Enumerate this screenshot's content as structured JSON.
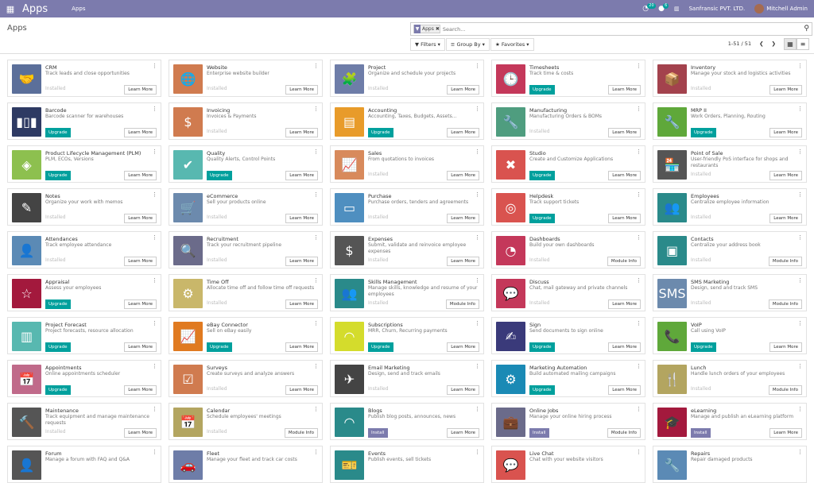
{
  "navbar": {
    "brand": "Apps",
    "menu": "Apps",
    "chat_count": "20",
    "activity_count": "6",
    "company": "Sanfransic PVT. LTD.",
    "user": "Mitchell Admin"
  },
  "page": {
    "title": "Apps"
  },
  "search": {
    "facet": "Apps",
    "placeholder": "Search..."
  },
  "filters": {
    "filters": "Filters",
    "group_by": "Group By",
    "favorites": "Favorites"
  },
  "pager": {
    "range": "1-51 / 51"
  },
  "colors": {
    "navbar": "#7c7bad",
    "teal": "#00a09d"
  },
  "apps": [
    {
      "name": "CRM",
      "desc": "Track leads and close opportunities",
      "state": "Installed",
      "action": "Learn More",
      "color": "#5b6f9a",
      "icon": "handshake-icon",
      "glyph": "🤝"
    },
    {
      "name": "Website",
      "desc": "Enterprise website builder",
      "state": "Installed",
      "action": "Learn More",
      "color": "#d07b4f",
      "icon": "globe-icon",
      "glyph": "🌐"
    },
    {
      "name": "Project",
      "desc": "Organize and schedule your projects",
      "state": "Installed",
      "action": "Learn More",
      "color": "#6e7da8",
      "icon": "puzzle-icon",
      "glyph": "🧩"
    },
    {
      "name": "Timesheets",
      "desc": "Track time & costs",
      "state": "Upgrade",
      "action": "Learn More",
      "color": "#c4385a",
      "icon": "clock-icon",
      "glyph": "🕒"
    },
    {
      "name": "Inventory",
      "desc": "Manage your stock and logistics activities",
      "state": "Installed",
      "action": "Learn More",
      "color": "#a3424d",
      "icon": "box-icon",
      "glyph": "📦"
    },
    {
      "name": "Barcode",
      "desc": "Barcode scanner for warehouses",
      "state": "Upgrade",
      "action": "Learn More",
      "color": "#2e3a63",
      "icon": "barcode-icon",
      "glyph": "▮▯▮"
    },
    {
      "name": "Invoicing",
      "desc": "Invoices & Payments",
      "state": "Installed",
      "action": "Learn More",
      "color": "#d07b4f",
      "icon": "invoice-icon",
      "glyph": "$"
    },
    {
      "name": "Accounting",
      "desc": "Accounting, Taxes, Budgets, Assets...",
      "state": "Upgrade",
      "action": "Learn More",
      "color": "#e89b2a",
      "icon": "document-icon",
      "glyph": "▤"
    },
    {
      "name": "Manufacturing",
      "desc": "Manufacturing Orders & BOMs",
      "state": "Installed",
      "action": "Learn More",
      "color": "#4f9d7f",
      "icon": "wrench-icon",
      "glyph": "🔧"
    },
    {
      "name": "MRP II",
      "desc": "Work Orders, Planning, Routing",
      "state": "Upgrade",
      "action": "Learn More",
      "color": "#5fa83a",
      "icon": "wrench-icon",
      "glyph": "🔧"
    },
    {
      "name": "Product Lifecycle Management (PLM)",
      "desc": "PLM, ECOs, Versions",
      "state": "Upgrade",
      "action": "Learn More",
      "color": "#8dc04f",
      "icon": "cube-icon",
      "glyph": "◈"
    },
    {
      "name": "Quality",
      "desc": "Quality Alerts, Control Points",
      "state": "Upgrade",
      "action": "Learn More",
      "color": "#58b8b0",
      "icon": "clipboard-check-icon",
      "glyph": "✔"
    },
    {
      "name": "Sales",
      "desc": "From quotations to invoices",
      "state": "Installed",
      "action": "Learn More",
      "color": "#d88a5c",
      "icon": "chart-line-icon",
      "glyph": "📈"
    },
    {
      "name": "Studio",
      "desc": "Create and Customize Applications",
      "state": "Upgrade",
      "action": "Learn More",
      "color": "#d9534f",
      "icon": "tools-icon",
      "glyph": "✖"
    },
    {
      "name": "Point of Sale",
      "desc": "User-friendly PoS interface for shops and restaurants",
      "state": "Installed",
      "action": "Learn More",
      "color": "#555555",
      "icon": "shop-icon",
      "glyph": "🏪"
    },
    {
      "name": "Notes",
      "desc": "Organize your work with memos",
      "state": "Installed",
      "action": "Learn More",
      "color": "#444444",
      "icon": "note-icon",
      "glyph": "✎"
    },
    {
      "name": "eCommerce",
      "desc": "Sell your products online",
      "state": "Installed",
      "action": "Learn More",
      "color": "#6c8aad",
      "icon": "cart-icon",
      "glyph": "🛒"
    },
    {
      "name": "Purchase",
      "desc": "Purchase orders, tenders and agreements",
      "state": "Installed",
      "action": "Learn More",
      "color": "#4f8fc0",
      "icon": "credit-card-icon",
      "glyph": "▭"
    },
    {
      "name": "Helpdesk",
      "desc": "Track support tickets",
      "state": "Upgrade",
      "action": "Learn More",
      "color": "#d9534f",
      "icon": "lifebuoy-icon",
      "glyph": "◎"
    },
    {
      "name": "Employees",
      "desc": "Centralize employee information",
      "state": "Installed",
      "action": "Learn More",
      "color": "#2a8a8a",
      "icon": "users-icon",
      "glyph": "👥"
    },
    {
      "name": "Attendances",
      "desc": "Track employee attendance",
      "state": "Installed",
      "action": "Learn More",
      "color": "#5b8ab5",
      "icon": "user-clock-icon",
      "glyph": "👤"
    },
    {
      "name": "Recruitment",
      "desc": "Track your recruitment pipeline",
      "state": "Installed",
      "action": "Learn More",
      "color": "#6b6b8a",
      "icon": "magnifier-icon",
      "glyph": "🔍"
    },
    {
      "name": "Expenses",
      "desc": "Submit, validate and reinvoice employee expenses",
      "state": "Installed",
      "action": "Learn More",
      "color": "#555555",
      "icon": "user-dollar-icon",
      "glyph": "$"
    },
    {
      "name": "Dashboards",
      "desc": "Build your own dashboards",
      "state": "Installed",
      "action": "Module Info",
      "color": "#c4385a",
      "icon": "gauge-icon",
      "glyph": "◔"
    },
    {
      "name": "Contacts",
      "desc": "Centralize your address book",
      "state": "Installed",
      "action": "Module Info",
      "color": "#2a8a8a",
      "icon": "contact-card-icon",
      "glyph": "▣"
    },
    {
      "name": "Appraisal",
      "desc": "Assess your employees",
      "state": "Upgrade",
      "action": "Learn More",
      "color": "#a3193d",
      "icon": "star-icon",
      "glyph": "☆"
    },
    {
      "name": "Time Off",
      "desc": "Allocate time off and follow time off requests",
      "state": "Installed",
      "action": "Learn More",
      "color": "#c9b76a",
      "icon": "user-gear-icon",
      "glyph": "⚙"
    },
    {
      "name": "Skills Management",
      "desc": "Manage skills, knowledge and resume of your employees",
      "state": "Installed",
      "action": "Module Info",
      "color": "#2a8a8a",
      "icon": "users-icon",
      "glyph": "👥"
    },
    {
      "name": "Discuss",
      "desc": "Chat, mail gateway and private channels",
      "state": "Installed",
      "action": "Learn More",
      "color": "#c4385a",
      "icon": "chat-bubble-icon",
      "glyph": "💬"
    },
    {
      "name": "SMS Marketing",
      "desc": "Design, send and track SMS",
      "state": "Installed",
      "action": "Module Info",
      "color": "#6c8aad",
      "icon": "phone-sms-icon",
      "glyph": "SMS"
    },
    {
      "name": "Project Forecast",
      "desc": "Project forecasts, resource allocation",
      "state": "Upgrade",
      "action": "Learn More",
      "color": "#58b8b0",
      "icon": "bar-chart-icon",
      "glyph": "▥"
    },
    {
      "name": "eBay Connector",
      "desc": "Sell on eBay easily",
      "state": "Upgrade",
      "action": "Learn More",
      "color": "#e07a20",
      "icon": "chart-line-icon",
      "glyph": "📈"
    },
    {
      "name": "Subscriptions",
      "desc": "MRR, Churn, Recurring payments",
      "state": "Upgrade",
      "action": "Learn More",
      "color": "#d4dc2c",
      "icon": "rss-icon",
      "glyph": "◠"
    },
    {
      "name": "Sign",
      "desc": "Send documents to sign online",
      "state": "Upgrade",
      "action": "Learn More",
      "color": "#3a3a7a",
      "icon": "sign-document-icon",
      "glyph": "✍"
    },
    {
      "name": "VoIP",
      "desc": "Call using VoIP",
      "state": "Upgrade",
      "action": "Learn More",
      "color": "#5fa83a",
      "icon": "phone-icon",
      "glyph": "📞"
    },
    {
      "name": "Appointments",
      "desc": "Online appointments scheduler",
      "state": "Upgrade",
      "action": "Learn More",
      "color": "#c06a8a",
      "icon": "calendar-clock-icon",
      "glyph": "📅"
    },
    {
      "name": "Surveys",
      "desc": "Create surveys and analyze answers",
      "state": "Installed",
      "action": "Learn More",
      "color": "#d07b4f",
      "icon": "survey-icon",
      "glyph": "☑"
    },
    {
      "name": "Email Marketing",
      "desc": "Design, send and track emails",
      "state": "Installed",
      "action": "Learn More",
      "color": "#444444",
      "icon": "paper-plane-icon",
      "glyph": "✈"
    },
    {
      "name": "Marketing Automation",
      "desc": "Build automated mailing campaigns",
      "state": "Upgrade",
      "action": "Learn More",
      "color": "#1a8ab5",
      "icon": "gear-mail-icon",
      "glyph": "⚙"
    },
    {
      "name": "Lunch",
      "desc": "Handle lunch orders of your employees",
      "state": "Installed",
      "action": "Module Info",
      "color": "#b3a560",
      "icon": "fork-knife-icon",
      "glyph": "🍴"
    },
    {
      "name": "Maintenance",
      "desc": "Track equipment and manage maintenance requests",
      "state": "Installed",
      "action": "Learn More",
      "color": "#555555",
      "icon": "hammer-icon",
      "glyph": "🔨"
    },
    {
      "name": "Calendar",
      "desc": "Schedule employees' meetings",
      "state": "Installed",
      "action": "Module Info",
      "color": "#b3a560",
      "icon": "calendar-icon",
      "glyph": "📅"
    },
    {
      "name": "Blogs",
      "desc": "Publish blog posts, announces, news",
      "state": "Install",
      "action": "Learn More",
      "color": "#2a8a8a",
      "icon": "rss-icon",
      "glyph": "◠"
    },
    {
      "name": "Online Jobs",
      "desc": "Manage your online hiring process",
      "state": "Install",
      "action": "Module Info",
      "color": "#6b6b8a",
      "icon": "briefcase-icon",
      "glyph": "💼"
    },
    {
      "name": "eLearning",
      "desc": "Manage and publish an eLearning platform",
      "state": "Install",
      "action": "Learn More",
      "color": "#a3193d",
      "icon": "graduation-icon",
      "glyph": "🎓"
    },
    {
      "name": "Forum",
      "desc": "Manage a forum with FAQ and Q&A",
      "state": "",
      "action": "",
      "color": "#555555",
      "icon": "user-icon",
      "glyph": "👤"
    },
    {
      "name": "Fleet",
      "desc": "Manage your fleet and track car costs",
      "state": "",
      "action": "",
      "color": "#6e7da8",
      "icon": "car-icon",
      "glyph": "🚗"
    },
    {
      "name": "Events",
      "desc": "Publish events, sell tickets",
      "state": "",
      "action": "",
      "color": "#2a8a8a",
      "icon": "ticket-icon",
      "glyph": "🎫"
    },
    {
      "name": "Live Chat",
      "desc": "Chat with your website visitors",
      "state": "",
      "action": "",
      "color": "#d9534f",
      "icon": "chat-bubble-icon",
      "glyph": "💬"
    },
    {
      "name": "Repairs",
      "desc": "Repair damaged products",
      "state": "",
      "action": "",
      "color": "#5b8ab5",
      "icon": "wrench-icon",
      "glyph": "🔧"
    }
  ]
}
